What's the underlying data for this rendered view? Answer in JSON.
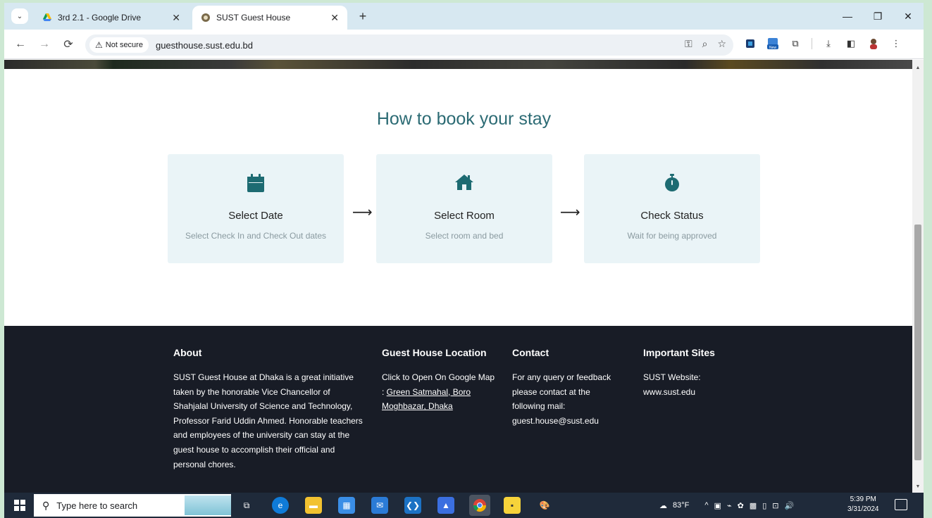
{
  "browser": {
    "tabs": [
      {
        "title": "3rd 2.1 - Google Drive",
        "active": false
      },
      {
        "title": "SUST Guest House",
        "active": true
      }
    ],
    "security_label": "Not secure",
    "url": "guesthouse.sust.edu.bd",
    "new_badge": "New"
  },
  "page": {
    "how_title": "How to book your stay",
    "steps": [
      {
        "title": "Select Date",
        "desc": "Select Check In and Check Out dates",
        "icon": "calendar-icon"
      },
      {
        "title": "Select Room",
        "desc": "Select room and bed",
        "icon": "home-icon"
      },
      {
        "title": "Check Status",
        "desc": "Wait for being approved",
        "icon": "stopwatch-icon"
      }
    ],
    "arrow": "⟶",
    "accent_color": "#2c6b74",
    "step_bg": "#eaf4f7"
  },
  "footer": {
    "about_title": "About",
    "about_text": "SUST Guest House at Dhaka is a great initiative taken by the honorable Vice Chancellor of Shahjalal University of Science and Technology, Professor Farid Uddin Ahmed. Honorable teachers and employees of the university can stay at the guest house to accomplish their official and personal chores.",
    "location_title": "Guest House Location",
    "location_prefix": "Click to Open On Google Map : ",
    "location_link": "Green Satmahal, Boro Moghbazar, Dhaka",
    "contact_title": "Contact",
    "contact_text": "For any query or feedback please contact at the following mail: guest.house@sust.edu",
    "sites_title": "Important Sites",
    "sites_text": "SUST Website: www.sust.edu",
    "bg_color": "#181c26"
  },
  "taskbar": {
    "search_placeholder": "Type here to search",
    "weather": "83°F",
    "time": "5:39 PM",
    "date": "3/31/2024"
  }
}
